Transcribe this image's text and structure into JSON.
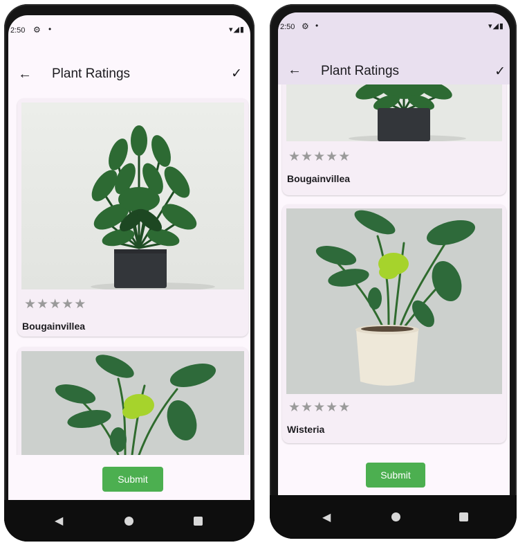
{
  "left_screen": {
    "status": {
      "time": "2:50",
      "gear_icon": "⚙",
      "dot": "•",
      "right_icons": "▾◢▮"
    },
    "app_bar": {
      "title": "Plant Ratings",
      "back_icon": "←",
      "check_icon": "✓"
    },
    "cards": [
      {
        "name": "Bougainvillea",
        "rating": 0,
        "image": "fan-palm-in-black-pot"
      },
      {
        "name": "",
        "rating": 0,
        "image": "monstera"
      }
    ],
    "submit_label": "Submit"
  },
  "right_screen": {
    "status": {
      "time": "2:50",
      "gear_icon": "⚙",
      "dot": "•",
      "right_icons": "▾◢▮"
    },
    "app_bar": {
      "title": "Plant Ratings",
      "back_icon": "←",
      "check_icon": "✓"
    },
    "cards": [
      {
        "name": "Bougainvillea",
        "rating": 0,
        "image": "fan-palm-in-black-pot"
      },
      {
        "name": "Wisteria",
        "rating": 0,
        "image": "monstera-in-white-pot"
      }
    ],
    "submit_label": "Submit"
  },
  "colors": {
    "screen_bg": "#fdf7fd",
    "app_bar_scrolled": "#e9e0ef",
    "card_bg": "#f6eef6",
    "star_inactive": "#9a9a9a",
    "submit_green": "#4caf50",
    "nav_bar": "#0e0e0e"
  },
  "star_glyph": "★★★★★"
}
